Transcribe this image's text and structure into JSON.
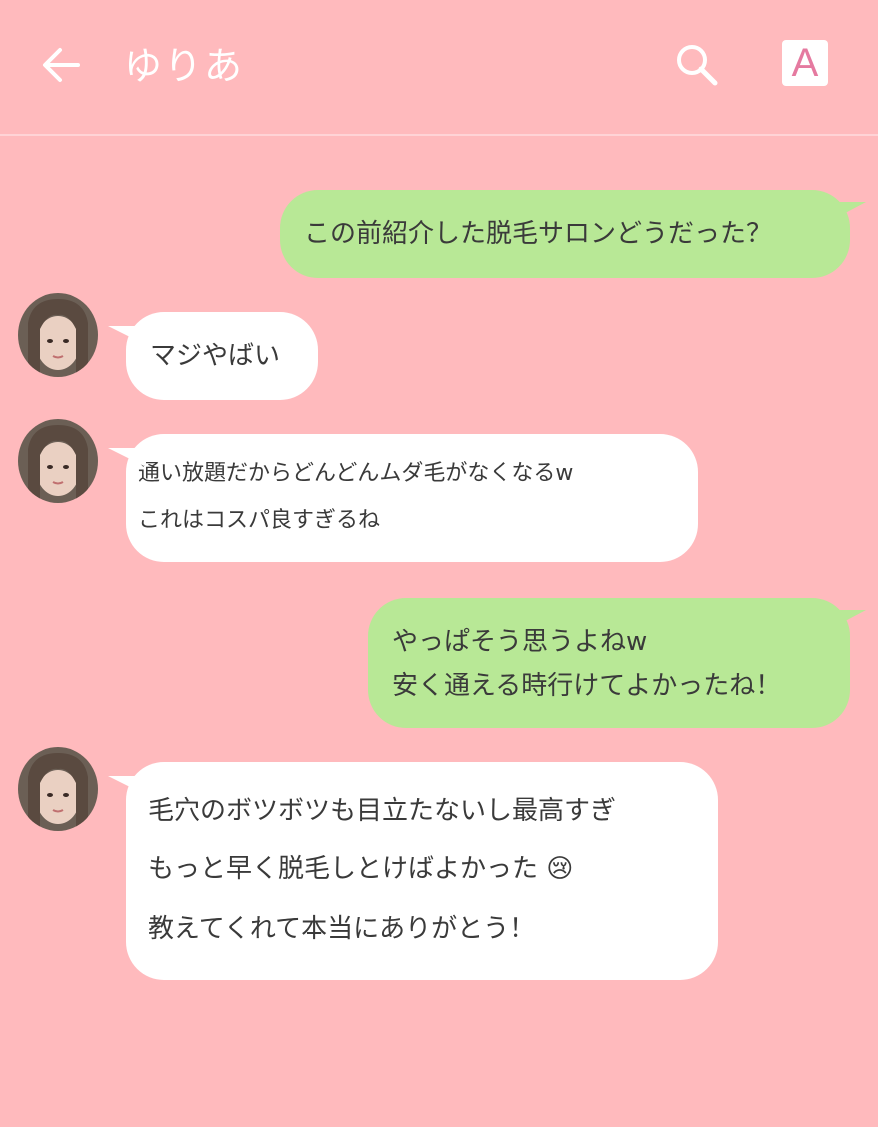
{
  "header": {
    "title": "ゆりあ",
    "back_icon": "arrow-left-icon",
    "search_icon": "search-icon",
    "font_size_label": "A"
  },
  "colors": {
    "background": "#ffbabd",
    "mine_bubble": "#b8e896",
    "their_bubble": "#ffffff",
    "text": "#3a3a3a"
  },
  "messages": [
    {
      "sender": "me",
      "lines": [
        "この前紹介した脱毛サロンどうだった？"
      ]
    },
    {
      "sender": "ゆりあ",
      "lines": [
        "マジやばい"
      ]
    },
    {
      "sender": "ゆりあ",
      "lines": [
        "通い放題だからどんどんムダ毛がなくなるw",
        "これはコスパ良すぎるね"
      ]
    },
    {
      "sender": "me",
      "lines": [
        "やっぱそう思うよねw",
        "安く通える時行けてよかったね！"
      ]
    },
    {
      "sender": "ゆりあ",
      "lines": [
        "毛穴のボツボツも目立たないし最高すぎ",
        "もっと早く脱毛しとけばよかった 😢",
        "教えてくれて本当にありがとう！"
      ]
    }
  ]
}
